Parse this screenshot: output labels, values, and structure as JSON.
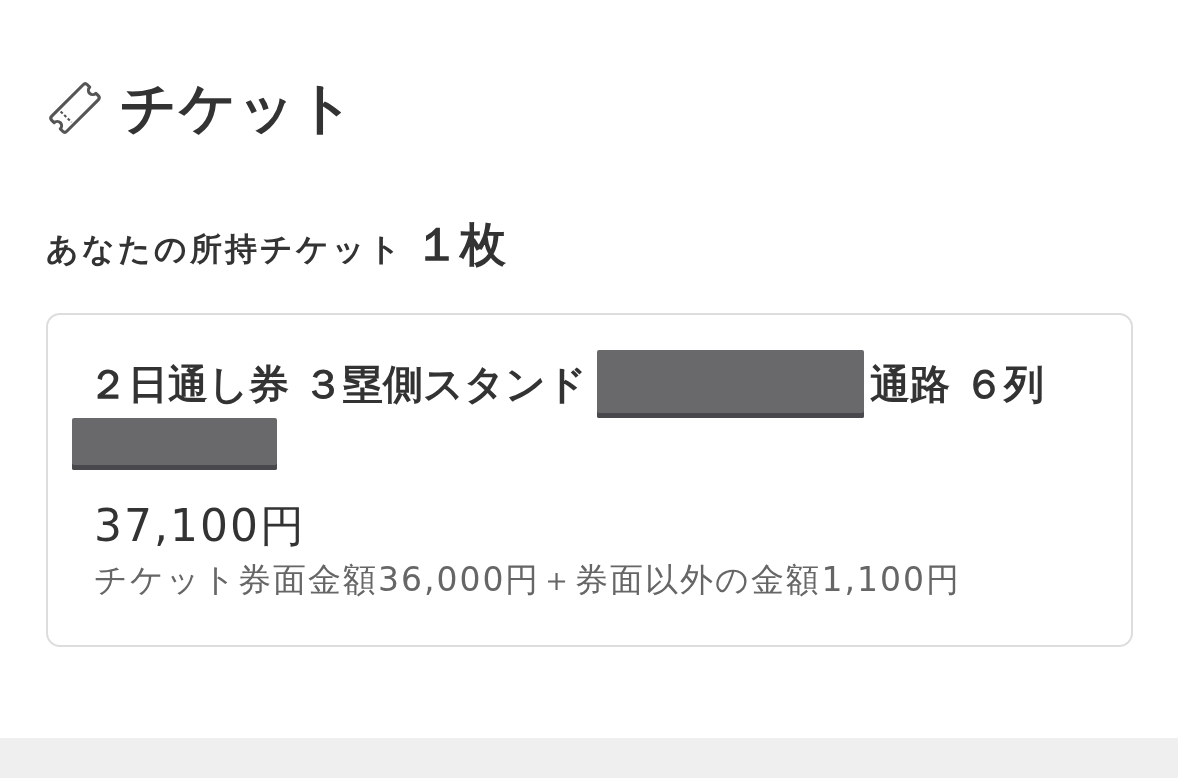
{
  "header": {
    "title": "チケット"
  },
  "summary": {
    "label": "あなたの所持チケット",
    "count": "１枚"
  },
  "tickets": [
    {
      "name_parts": [
        {
          "kind": "text",
          "text": "２日通し券 ３塁側スタンド"
        },
        {
          "kind": "redacted"
        },
        {
          "kind": "text",
          "text": "通路 ６列"
        },
        {
          "kind": "redacted"
        }
      ],
      "price": "37,100円",
      "breakdown": "チケット券面金額36,000円＋券面以外の金額1,100円"
    }
  ]
}
